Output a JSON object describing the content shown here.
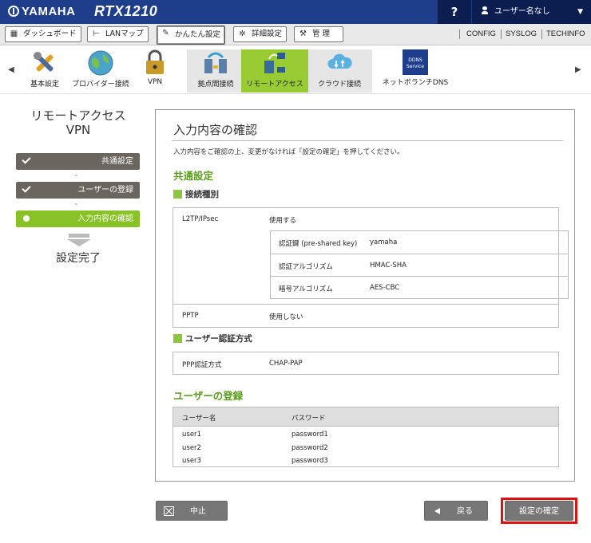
{
  "header": {
    "brand": "YAMAHA",
    "model": "RTX1210",
    "help_label": "?",
    "user_label": "ユーザー名なし"
  },
  "menubar": {
    "dashboard": "ダッシュボード",
    "lanmap": "LANマップ",
    "easy_setup": "かんたん設定",
    "detail_setup": "詳細設定",
    "management": "管 理",
    "config": "CONFIG",
    "syslog": "SYSLOG",
    "techinfo": "TECHINFO"
  },
  "subnav": {
    "items": [
      {
        "label": "基本設定"
      },
      {
        "label": "プロバイダー接続"
      },
      {
        "label": "VPN"
      },
      {
        "label": "拠点間接続"
      },
      {
        "label": "リモートアクセス"
      },
      {
        "label": "クラウド接続"
      },
      {
        "label": "ネットボランチDNS"
      }
    ],
    "ddns_logo_line1": "DDNS",
    "ddns_logo_line2": "Service"
  },
  "wizard": {
    "title_line1": "リモートアクセス",
    "title_line2": "VPN",
    "steps": [
      {
        "label": "共通設定",
        "state": "done"
      },
      {
        "label": "ユーザーの登録",
        "state": "done"
      },
      {
        "label": "入力内容の確認",
        "state": "current"
      }
    ],
    "final_step": "設定完了"
  },
  "main": {
    "title": "入力内容の確認",
    "description": "入力内容をご確認の上、変更がなければ「設定の確定」を押してください。",
    "common": {
      "title": "共通設定",
      "conn_type_title": "接続種別",
      "l2tp_label": "L2TP/IPsec",
      "l2tp_value": "使用する",
      "l2tp_details": [
        {
          "label": "認証鍵 (pre-shared key)",
          "value": "yamaha"
        },
        {
          "label": "認証アルゴリズム",
          "value": "HMAC-SHA"
        },
        {
          "label": "暗号アルゴリズム",
          "value": "AES-CBC"
        }
      ],
      "pptp_label": "PPTP",
      "pptp_value": "使用しない",
      "auth_title": "ユーザー認証方式",
      "ppp_label": "PPP認証方式",
      "ppp_value": "CHAP-PAP"
    },
    "users": {
      "title": "ユーザーの登録",
      "col_name": "ユーザー名",
      "col_password": "パスワード",
      "rows": [
        {
          "name": "user1",
          "password": "password1"
        },
        {
          "name": "user2",
          "password": "password2"
        },
        {
          "name": "user3",
          "password": "password3"
        }
      ]
    }
  },
  "footer": {
    "cancel": "中止",
    "back": "戻る",
    "confirm": "設定の確定"
  },
  "colors": {
    "header_bg": "#1e3d8a",
    "accent_green": "#88c226",
    "section_green": "#5a9a1c",
    "highlight_red": "#e01010"
  }
}
